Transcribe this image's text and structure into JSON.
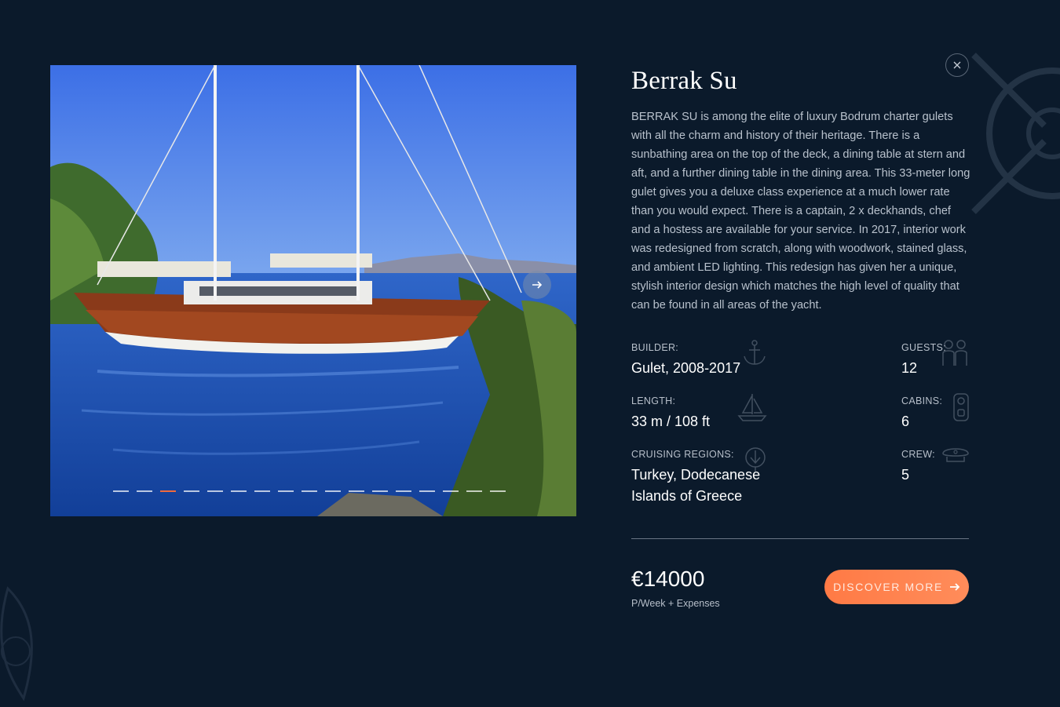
{
  "yacht": {
    "name": "Berrak Su",
    "description": "BERRAK SU is among the elite of luxury Bodrum charter gulets with all the charm and history of their heritage. There is a sunbathing area on the top of the deck, a dining table at stern and aft, and a further dining table in the dining area.  This 33-meter long gulet gives you a deluxe class experience at a much lower rate than you would expect. There is a captain, 2 x deckhands, chef and a hostess are available for your service. In 2017, interior work was redesigned from scratch, along with woodwork, stained glass, and ambient LED lighting. This redesign has given her a unique, stylish interior design which matches the high level of quality that can be found in all areas of the yacht."
  },
  "specs": {
    "builder": {
      "label": "BUILDER:",
      "value": "Gulet, 2008-2017",
      "icon": "anchor-icon"
    },
    "guests": {
      "label": "GUESTS:",
      "value": "12",
      "icon": "people-icon"
    },
    "length": {
      "label": "LENGTH:",
      "value": "33 m / 108 ft",
      "icon": "sailboat-icon"
    },
    "cabins": {
      "label": "CABINS:",
      "value": "6",
      "icon": "door-hanger-icon"
    },
    "regions": {
      "label": "CRUISING REGIONS:",
      "value": "Turkey, Dodecanese Islands of Greece",
      "icon": "map-pin-icon"
    },
    "crew": {
      "label": "CREW:",
      "value": "5",
      "icon": "captain-hat-icon"
    }
  },
  "pricing": {
    "price": "€14000",
    "note": "P/Week + Expenses"
  },
  "actions": {
    "discover_label": "DISCOVER MORE"
  },
  "gallery": {
    "slide_count": 17,
    "active_index": 2
  },
  "colors": {
    "background": "#0b1a2b",
    "accent": "#ff7a45",
    "active_dot": "#f06a3d"
  }
}
